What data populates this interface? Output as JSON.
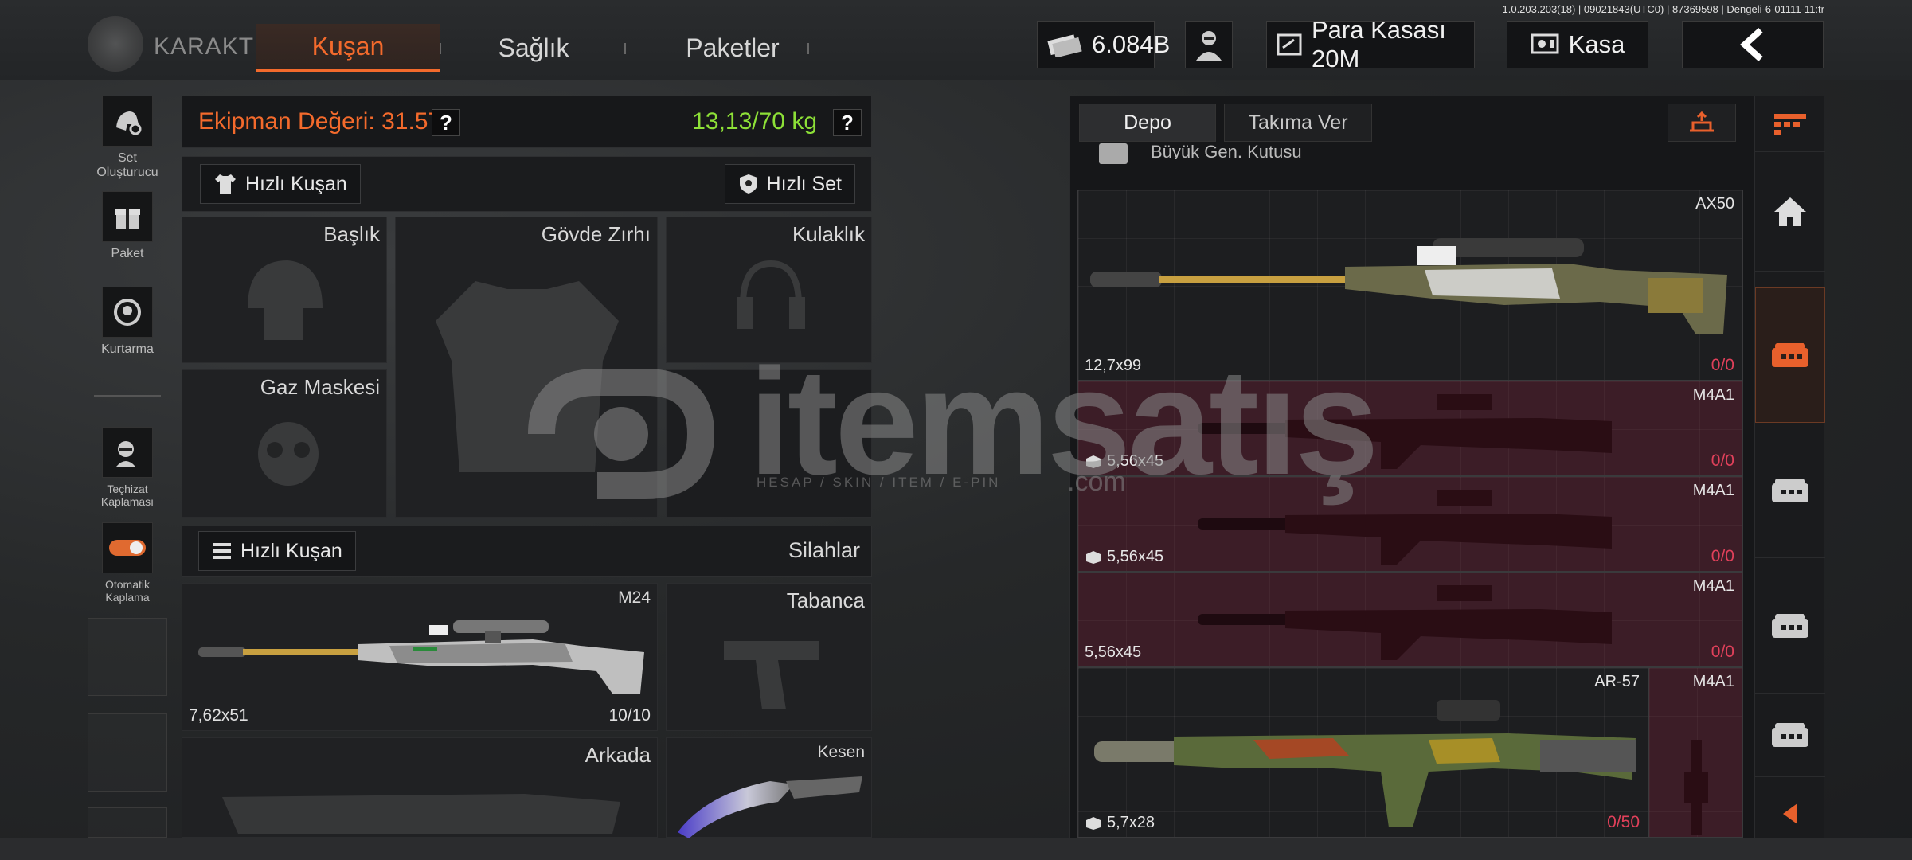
{
  "version": "1.0.203.203(18) | 09021843(UTC0) | 87369598 | Dengeli-6-01111-11:tr",
  "logo_text": "KARAKTER",
  "tabs": [
    {
      "label": "Kuşan",
      "active": true
    },
    {
      "label": "Sağlık",
      "active": false
    },
    {
      "label": "Paketler",
      "active": false
    }
  ],
  "top": {
    "currency": "6.084B",
    "vault": "Para Kasası 20M",
    "safe": "Kasa"
  },
  "sidebar": [
    {
      "label": "Set Oluşturucu",
      "icon": "set-builder-icon"
    },
    {
      "label": "Paket",
      "icon": "gift-icon"
    },
    {
      "label": "Kurtarma",
      "icon": "rescue-icon"
    },
    {
      "label": "Teçhizat Kaplaması",
      "icon": "gear-skin-icon"
    },
    {
      "label": "Otomatik Kaplama",
      "icon": "toggle-icon"
    }
  ],
  "equipment": {
    "value_label": "Ekipman Değeri: 31.575",
    "weight_label": "13,13/70 kg",
    "help": "?",
    "quick_equip": "Hızlı Kuşan",
    "quick_set": "Hızlı Set",
    "slots": {
      "head": "Başlık",
      "body": "Gövde Zırhı",
      "headset": "Kulaklık",
      "gasmask": "Gaz Maskesi"
    }
  },
  "weapons": {
    "quick_equip": "Hızlı Kuşan",
    "title": "Silahlar",
    "primary": {
      "name": "M24",
      "caliber": "7,62x51",
      "ammo": "10/10"
    },
    "pistol": "Tabanca",
    "back": "Arkada",
    "melee": "Kesen"
  },
  "storage": {
    "tabs": [
      {
        "label": "Depo",
        "active": true
      },
      {
        "label": "Takıma Ver",
        "active": false
      }
    ],
    "header_item": "Büyük Gen. Kutusu",
    "items": [
      {
        "name": "AX50",
        "caliber": "12,7x99",
        "ammo": "0/0",
        "style": "normal",
        "box": false
      },
      {
        "name": "M4A1",
        "caliber": "5,56x45",
        "ammo": "0/0",
        "style": "red",
        "box": true
      },
      {
        "name": "M4A1",
        "caliber": "5,56x45",
        "ammo": "0/0",
        "style": "red",
        "box": true
      },
      {
        "name": "M4A1",
        "caliber": "5,56x45",
        "ammo": "0/0",
        "style": "red",
        "box": false
      }
    ],
    "bottom_left": {
      "name": "AR-57",
      "caliber": "5,7x28",
      "ammo": "0/50"
    },
    "bottom_right": {
      "name": "M4A1"
    }
  },
  "watermark": {
    "brand": "itemsatış",
    "domain": ".com",
    "tagline": "HESAP / SKIN / ITEM / E-PIN"
  }
}
